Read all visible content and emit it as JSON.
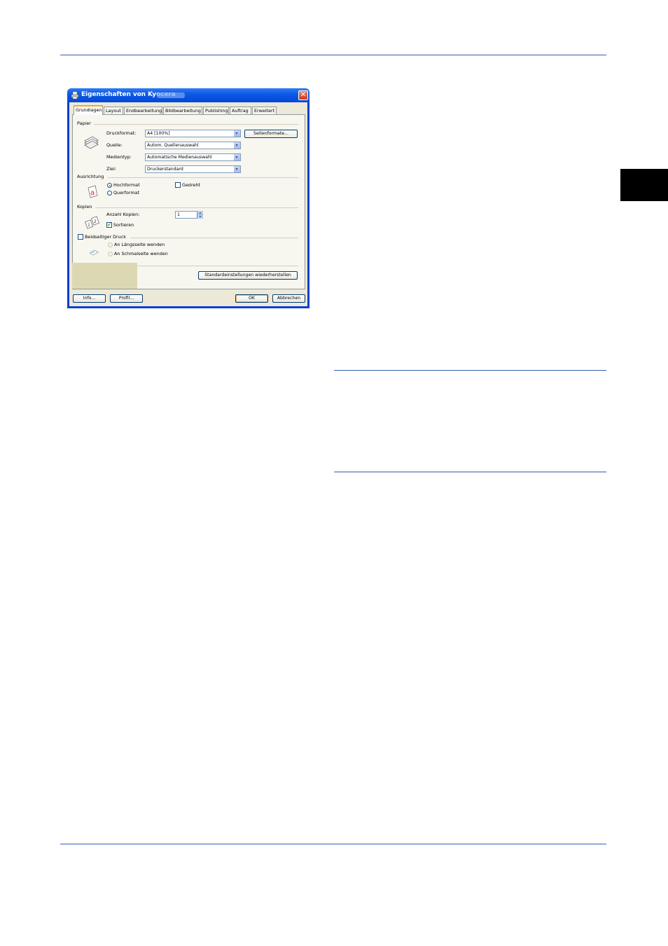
{
  "window": {
    "title": "Eigenschaften von Kyocera",
    "close_symbol": "✕"
  },
  "tabs": [
    {
      "label": "Grundlagen",
      "active": true
    },
    {
      "label": "Layout"
    },
    {
      "label": "Endbearbeitung"
    },
    {
      "label": "Bildbearbeitung"
    },
    {
      "label": "Publishing"
    },
    {
      "label": "Auftrag"
    },
    {
      "label": "Erweitert"
    }
  ],
  "papier": {
    "group_label": "Papier",
    "druckformat_label": "Druckformat:",
    "druckformat_value": "A4  [100%]",
    "quelle_label": "Quelle:",
    "quelle_value": "Autom. Quellenauswahl",
    "medientyp_label": "Medientyp:",
    "medientyp_value": "Automatische Medienauswahl",
    "ziel_label": "Ziel:",
    "ziel_value": "Druckerstandard",
    "seitenformate_button": "Seitenformate..."
  },
  "ausrichtung": {
    "group_label": "Ausrichtung",
    "hochformat": "Hochformat",
    "querformat": "Querformat",
    "gedreht": "Gedreht",
    "selected": "Hochformat"
  },
  "kopien": {
    "group_label": "Kopien",
    "anzahl_label": "Anzahl Kopien:",
    "anzahl_value": "1",
    "sortieren": "Sortieren",
    "sortieren_checked": true
  },
  "duplex": {
    "beidseitig": "Beidseitiger Druck",
    "beidseitig_checked": false,
    "laengsseite": "An Längsseite wenden",
    "schmalseite": "An Schmalseite wenden"
  },
  "buttons": {
    "standard": "Standardeinstellungen wiederherstellen",
    "info": "Info...",
    "profil": "Profil...",
    "ok": "OK",
    "abbrechen": "Abbrechen"
  },
  "colors": {
    "rule": "#3060b0",
    "titlebar": "#0546d6",
    "side_tab": "#000000"
  }
}
